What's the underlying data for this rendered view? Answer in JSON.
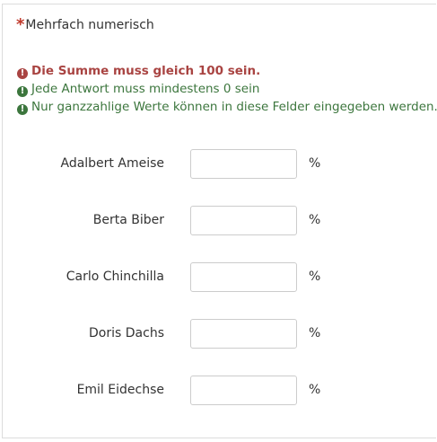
{
  "question": {
    "required_mark": "*",
    "title": "Mehrfach numerisch"
  },
  "tips": [
    {
      "icon": "exclamation-circle-icon",
      "text": "Die Summe muss gleich 100 sein.",
      "status": "error",
      "color": "#a94442"
    },
    {
      "icon": "exclamation-circle-icon",
      "text": "Jede Antwort muss mindestens 0 sein",
      "status": "ok",
      "color": "#3c763d"
    },
    {
      "icon": "exclamation-circle-icon",
      "text": "Nur ganzzahlige Werte können in diese Felder eingegeben werden.",
      "status": "ok",
      "color": "#3c763d"
    }
  ],
  "rows": [
    {
      "label": "Adalbert Ameise",
      "value": "",
      "unit": "%"
    },
    {
      "label": "Berta Biber",
      "value": "",
      "unit": "%"
    },
    {
      "label": "Carlo Chinchilla",
      "value": "",
      "unit": "%"
    },
    {
      "label": "Doris Dachs",
      "value": "",
      "unit": "%"
    },
    {
      "label": "Emil Eidechse",
      "value": "",
      "unit": "%"
    }
  ],
  "colors": {
    "required": "#c0392b",
    "error": "#a94442",
    "ok": "#3c763d"
  }
}
